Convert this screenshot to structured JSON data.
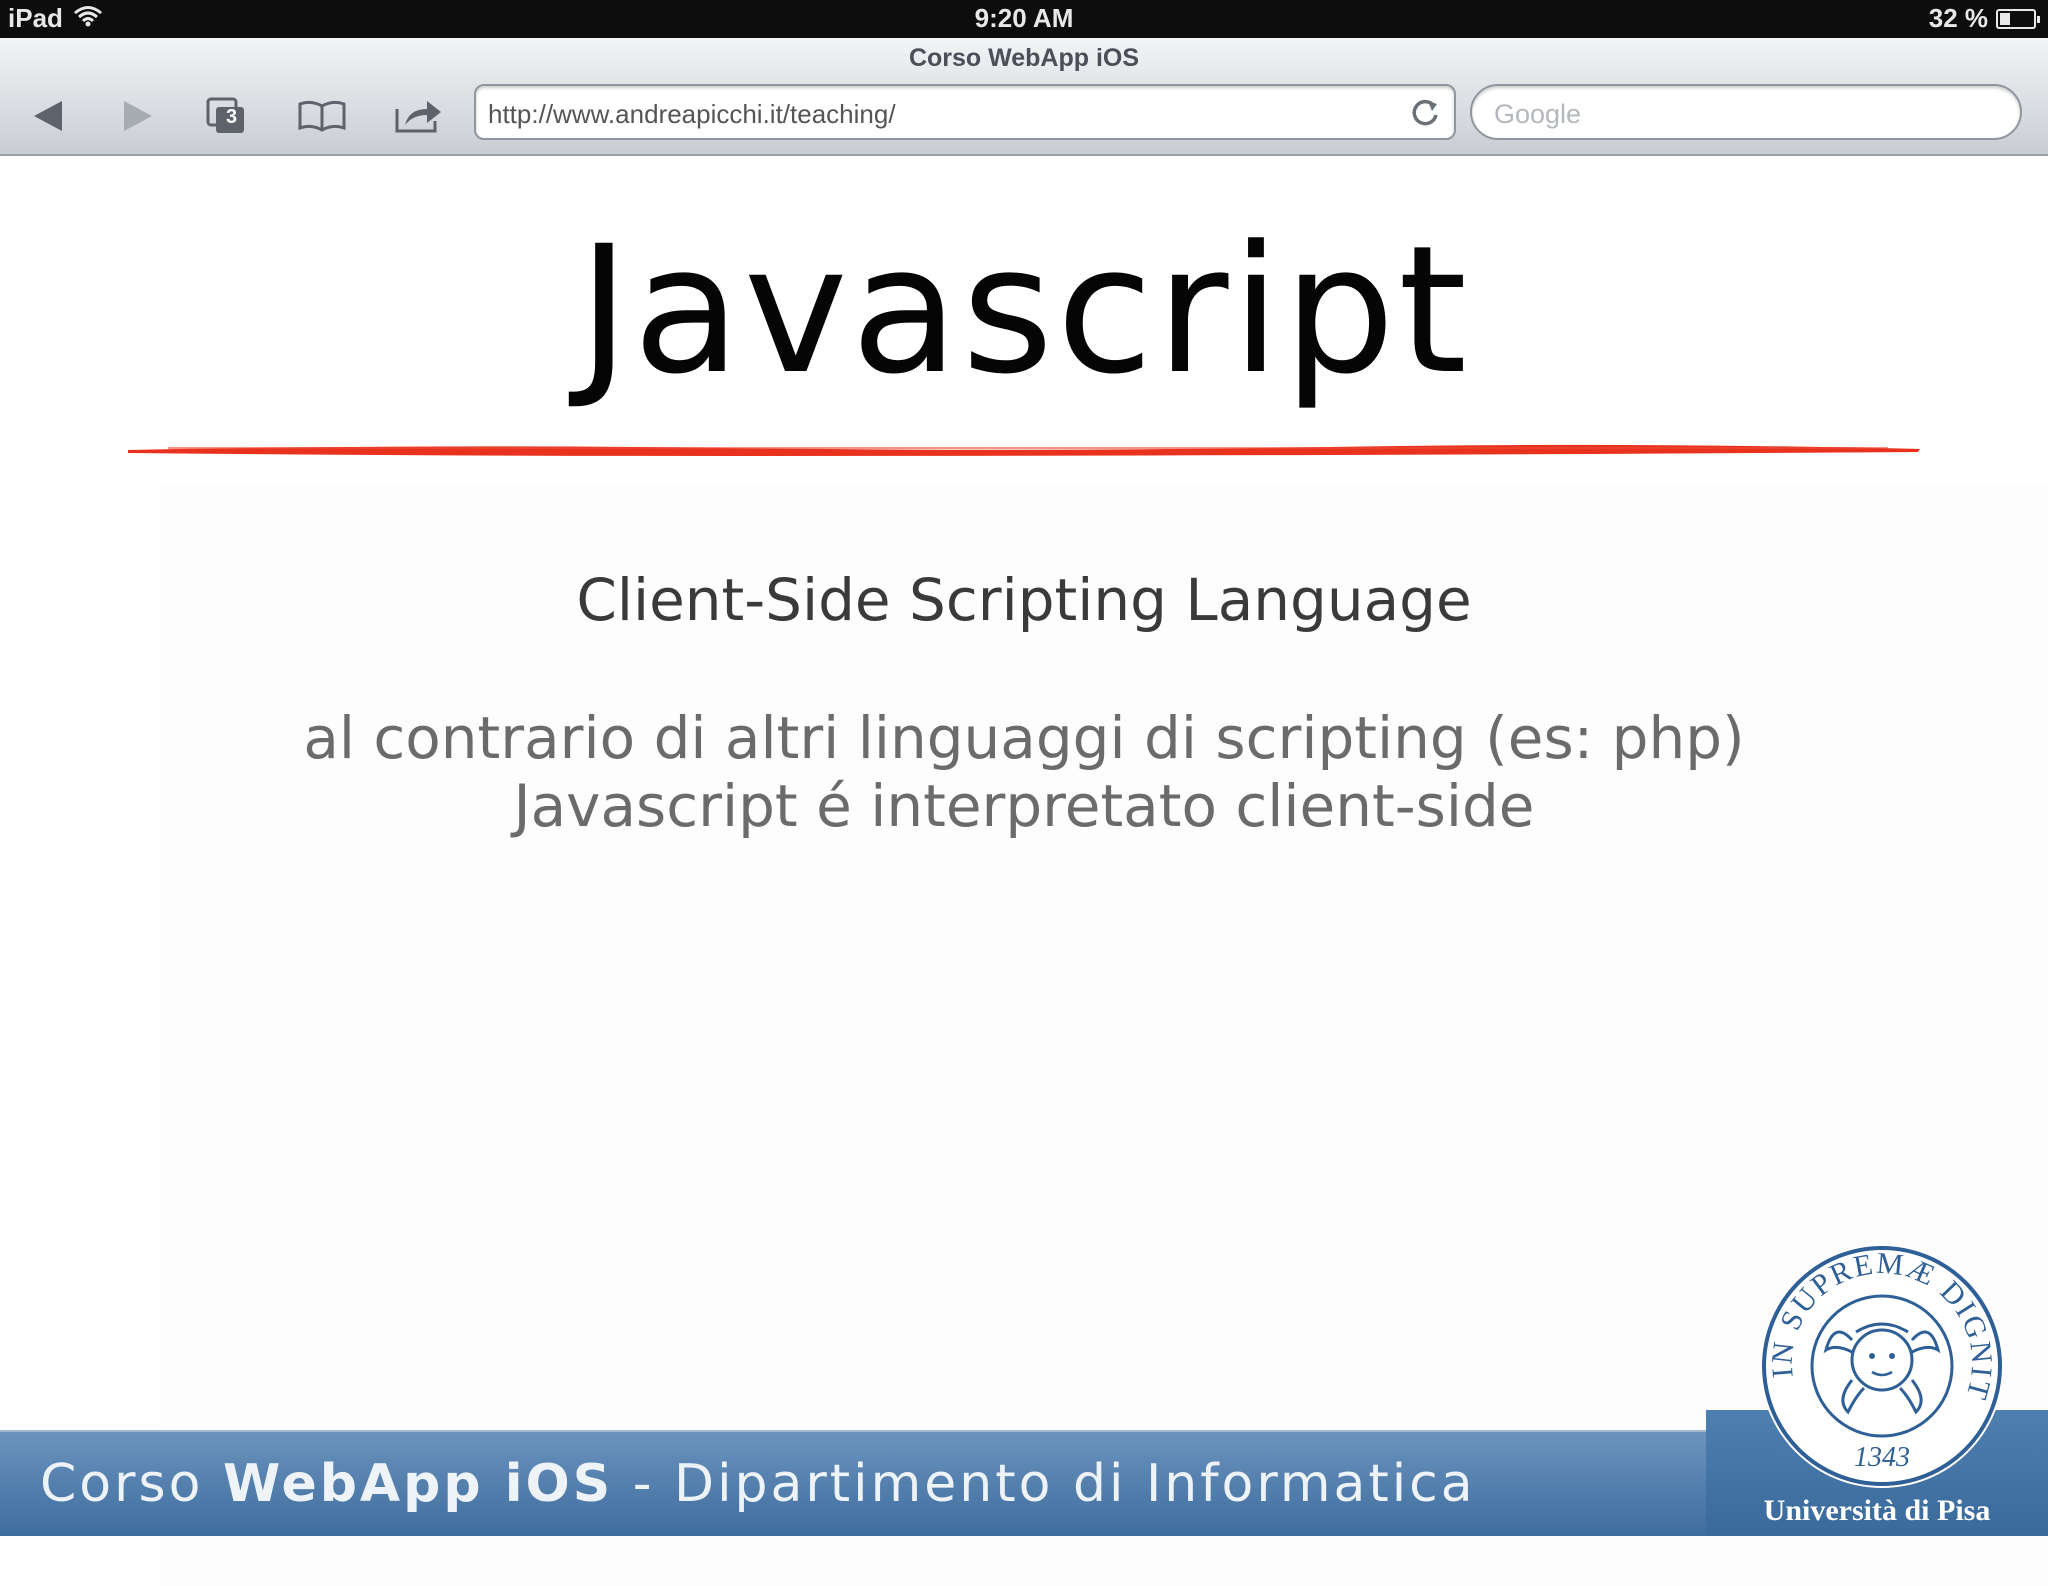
{
  "status_bar": {
    "device": "iPad",
    "time": "9:20 AM",
    "battery": "32 %",
    "battery_level": 0.32
  },
  "browser": {
    "page_title": "Corso WebApp iOS",
    "tab_count": "3",
    "url": "http://www.andreapicchi.it/teaching/",
    "search_placeholder": "Google",
    "icons": [
      "back-arrow-icon",
      "forward-arrow-icon",
      "tabs-icon",
      "bookmarks-icon",
      "share-icon",
      "reload-icon"
    ]
  },
  "slide": {
    "title": "Javascript",
    "subtitle": "Client-Side Scripting Language",
    "body_line_1": "al contrario di altri linguaggi di scripting (es: php)",
    "body_line_2": "Javascript é interpretato client-side",
    "accent_color": "#e8321e"
  },
  "footer": {
    "text_prefix": "Corso ",
    "text_strong": "WebApp iOS",
    "text_suffix": " - Dipartimento di Informatica",
    "university": "Università di Pisa",
    "seal_motto": "IN SUPREMÆ DIGNITATIS",
    "seal_year": "1343",
    "bar_color": "#4d7cad"
  }
}
